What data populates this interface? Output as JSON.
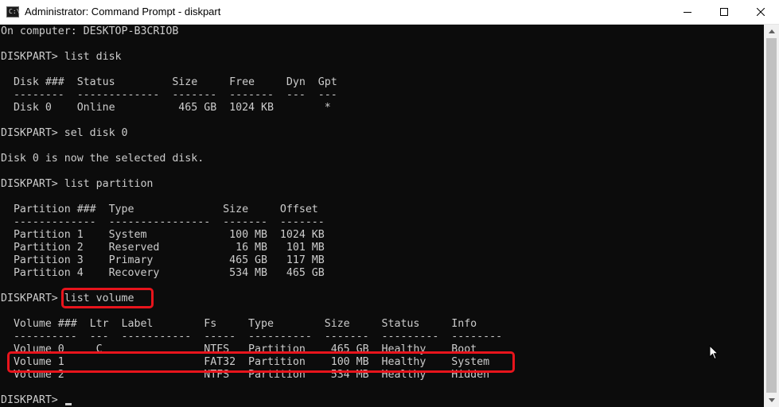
{
  "window": {
    "title": "Administrator: Command Prompt - diskpart",
    "app_icon_text": "C:\\",
    "controls": [
      "minimize-icon",
      "maximize-icon",
      "close-icon"
    ]
  },
  "console": {
    "lines": [
      "On computer: DESKTOP-B3CRIOB",
      "",
      "DISKPART> list disk",
      "",
      "  Disk ###  Status         Size     Free     Dyn  Gpt",
      "  --------  -------------  -------  -------  ---  ---",
      "  Disk 0    Online          465 GB  1024 KB        *",
      "",
      "DISKPART> sel disk 0",
      "",
      "Disk 0 is now the selected disk.",
      "",
      "DISKPART> list partition",
      "",
      "  Partition ###  Type              Size     Offset",
      "  -------------  ----------------  -------  -------",
      "  Partition 1    System             100 MB  1024 KB",
      "  Partition 2    Reserved            16 MB   101 MB",
      "  Partition 3    Primary            465 GB   117 MB",
      "  Partition 4    Recovery           534 MB   465 GB",
      "",
      "DISKPART> list volume",
      "",
      "  Volume ###  Ltr  Label        Fs     Type        Size     Status     Info",
      "  ----------  ---  -----------  -----  ----------  -------  ---------  --------",
      "  Volume 0     C                NTFS   Partition    465 GB  Healthy    Boot",
      "  Volume 1                      FAT32  Partition    100 MB  Healthy    System",
      "  Volume 2                      NTFS   Partition    534 MB  Healthy    Hidden",
      "",
      "DISKPART> "
    ],
    "text_color": "#cccccc",
    "background_color": "#0c0c0c"
  },
  "annotations": {
    "highlight_color": "#e8141c",
    "highlighted_command": "list volume",
    "highlighted_row": "Volume 1"
  }
}
